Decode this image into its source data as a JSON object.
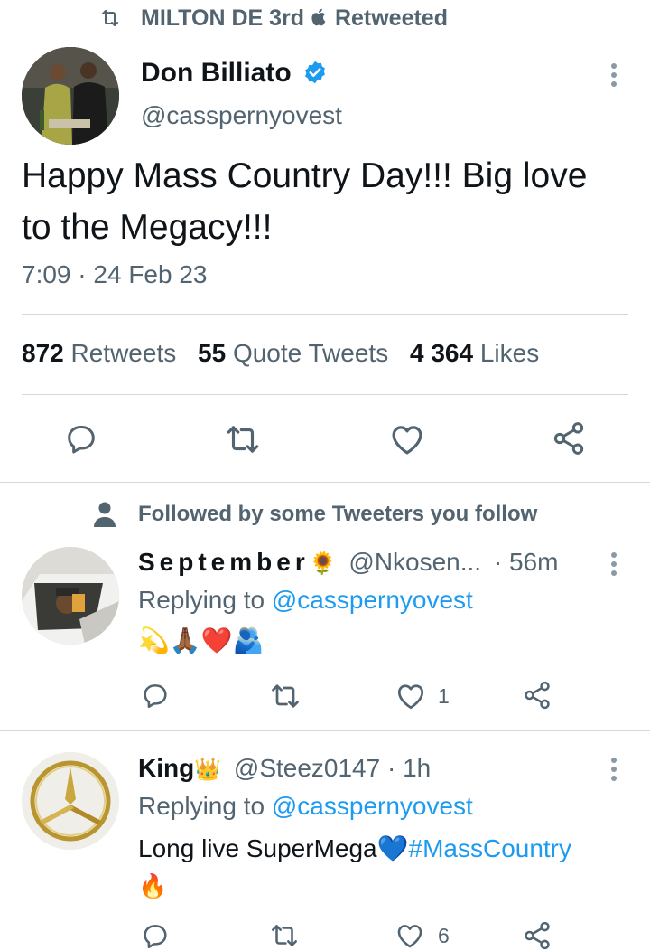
{
  "social_context": {
    "text": "MILTON DE 3rd",
    "suffix": "Retweeted"
  },
  "tweet": {
    "display_name": "Don Billiato",
    "handle": "@casspernyovest",
    "text": "Happy Mass Country Day!!! Big love to the Megacy!!!",
    "time": "7:09",
    "sep": "·",
    "date": "24 Feb 23",
    "stats": {
      "retweets_count": "872",
      "retweets_label": "Retweets",
      "quotes_count": "55",
      "quotes_label": "Quote Tweets",
      "likes_count": "4 364",
      "likes_label": "Likes"
    }
  },
  "followed_notice": "Followed by some Tweeters you follow",
  "replies": [
    {
      "name": "September",
      "name_emoji": "🌻",
      "handle": "@Nkosen...",
      "time": "· 56m",
      "replying_prefix": "Replying to",
      "replying_to": "@casspernyovest",
      "text": "💫🙏🏾❤️🫂",
      "likes": "1"
    },
    {
      "name": "King",
      "name_emoji": "👑",
      "handle": "@Steez0147",
      "time": "· 1h",
      "replying_prefix": "Replying to",
      "replying_to": "@casspernyovest",
      "text": "Long live SuperMega",
      "heart_emoji": "💙",
      "hashtag": "#MassCountry",
      "fire_emoji": "🔥",
      "likes": "6"
    }
  ],
  "colors": {
    "accent": "#1d9bf0",
    "text": "#0f1419",
    "secondary": "#536471",
    "divider": "#cfd9de"
  }
}
